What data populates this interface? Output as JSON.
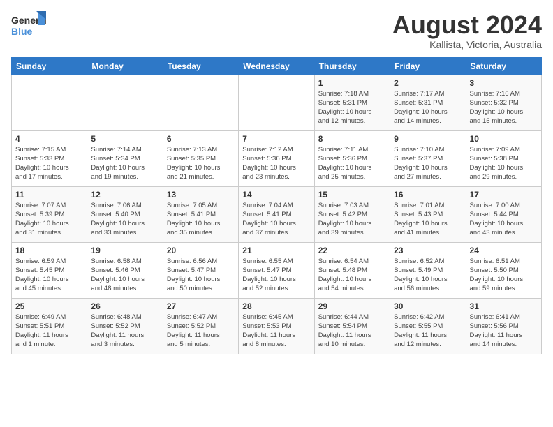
{
  "header": {
    "logo_general": "General",
    "logo_blue": "Blue",
    "title": "August 2024",
    "subtitle": "Kallista, Victoria, Australia"
  },
  "weekdays": [
    "Sunday",
    "Monday",
    "Tuesday",
    "Wednesday",
    "Thursday",
    "Friday",
    "Saturday"
  ],
  "rows": [
    [
      {
        "day": "",
        "info": ""
      },
      {
        "day": "",
        "info": ""
      },
      {
        "day": "",
        "info": ""
      },
      {
        "day": "",
        "info": ""
      },
      {
        "day": "1",
        "info": "Sunrise: 7:18 AM\nSunset: 5:31 PM\nDaylight: 10 hours\nand 12 minutes."
      },
      {
        "day": "2",
        "info": "Sunrise: 7:17 AM\nSunset: 5:31 PM\nDaylight: 10 hours\nand 14 minutes."
      },
      {
        "day": "3",
        "info": "Sunrise: 7:16 AM\nSunset: 5:32 PM\nDaylight: 10 hours\nand 15 minutes."
      }
    ],
    [
      {
        "day": "4",
        "info": "Sunrise: 7:15 AM\nSunset: 5:33 PM\nDaylight: 10 hours\nand 17 minutes."
      },
      {
        "day": "5",
        "info": "Sunrise: 7:14 AM\nSunset: 5:34 PM\nDaylight: 10 hours\nand 19 minutes."
      },
      {
        "day": "6",
        "info": "Sunrise: 7:13 AM\nSunset: 5:35 PM\nDaylight: 10 hours\nand 21 minutes."
      },
      {
        "day": "7",
        "info": "Sunrise: 7:12 AM\nSunset: 5:36 PM\nDaylight: 10 hours\nand 23 minutes."
      },
      {
        "day": "8",
        "info": "Sunrise: 7:11 AM\nSunset: 5:36 PM\nDaylight: 10 hours\nand 25 minutes."
      },
      {
        "day": "9",
        "info": "Sunrise: 7:10 AM\nSunset: 5:37 PM\nDaylight: 10 hours\nand 27 minutes."
      },
      {
        "day": "10",
        "info": "Sunrise: 7:09 AM\nSunset: 5:38 PM\nDaylight: 10 hours\nand 29 minutes."
      }
    ],
    [
      {
        "day": "11",
        "info": "Sunrise: 7:07 AM\nSunset: 5:39 PM\nDaylight: 10 hours\nand 31 minutes."
      },
      {
        "day": "12",
        "info": "Sunrise: 7:06 AM\nSunset: 5:40 PM\nDaylight: 10 hours\nand 33 minutes."
      },
      {
        "day": "13",
        "info": "Sunrise: 7:05 AM\nSunset: 5:41 PM\nDaylight: 10 hours\nand 35 minutes."
      },
      {
        "day": "14",
        "info": "Sunrise: 7:04 AM\nSunset: 5:41 PM\nDaylight: 10 hours\nand 37 minutes."
      },
      {
        "day": "15",
        "info": "Sunrise: 7:03 AM\nSunset: 5:42 PM\nDaylight: 10 hours\nand 39 minutes."
      },
      {
        "day": "16",
        "info": "Sunrise: 7:01 AM\nSunset: 5:43 PM\nDaylight: 10 hours\nand 41 minutes."
      },
      {
        "day": "17",
        "info": "Sunrise: 7:00 AM\nSunset: 5:44 PM\nDaylight: 10 hours\nand 43 minutes."
      }
    ],
    [
      {
        "day": "18",
        "info": "Sunrise: 6:59 AM\nSunset: 5:45 PM\nDaylight: 10 hours\nand 45 minutes."
      },
      {
        "day": "19",
        "info": "Sunrise: 6:58 AM\nSunset: 5:46 PM\nDaylight: 10 hours\nand 48 minutes."
      },
      {
        "day": "20",
        "info": "Sunrise: 6:56 AM\nSunset: 5:47 PM\nDaylight: 10 hours\nand 50 minutes."
      },
      {
        "day": "21",
        "info": "Sunrise: 6:55 AM\nSunset: 5:47 PM\nDaylight: 10 hours\nand 52 minutes."
      },
      {
        "day": "22",
        "info": "Sunrise: 6:54 AM\nSunset: 5:48 PM\nDaylight: 10 hours\nand 54 minutes."
      },
      {
        "day": "23",
        "info": "Sunrise: 6:52 AM\nSunset: 5:49 PM\nDaylight: 10 hours\nand 56 minutes."
      },
      {
        "day": "24",
        "info": "Sunrise: 6:51 AM\nSunset: 5:50 PM\nDaylight: 10 hours\nand 59 minutes."
      }
    ],
    [
      {
        "day": "25",
        "info": "Sunrise: 6:49 AM\nSunset: 5:51 PM\nDaylight: 11 hours\nand 1 minute."
      },
      {
        "day": "26",
        "info": "Sunrise: 6:48 AM\nSunset: 5:52 PM\nDaylight: 11 hours\nand 3 minutes."
      },
      {
        "day": "27",
        "info": "Sunrise: 6:47 AM\nSunset: 5:52 PM\nDaylight: 11 hours\nand 5 minutes."
      },
      {
        "day": "28",
        "info": "Sunrise: 6:45 AM\nSunset: 5:53 PM\nDaylight: 11 hours\nand 8 minutes."
      },
      {
        "day": "29",
        "info": "Sunrise: 6:44 AM\nSunset: 5:54 PM\nDaylight: 11 hours\nand 10 minutes."
      },
      {
        "day": "30",
        "info": "Sunrise: 6:42 AM\nSunset: 5:55 PM\nDaylight: 11 hours\nand 12 minutes."
      },
      {
        "day": "31",
        "info": "Sunrise: 6:41 AM\nSunset: 5:56 PM\nDaylight: 11 hours\nand 14 minutes."
      }
    ]
  ]
}
